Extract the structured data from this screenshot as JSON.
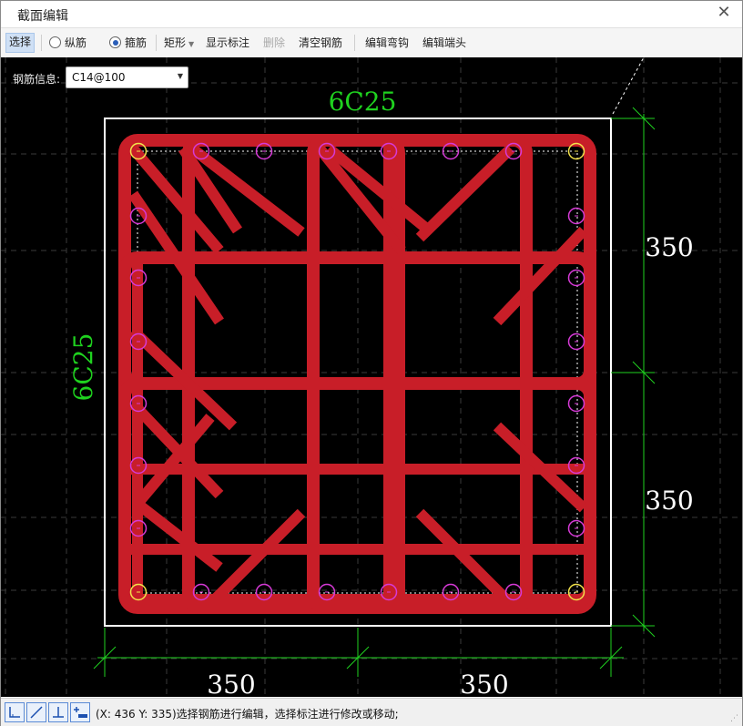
{
  "window": {
    "title": "截面编辑",
    "close_glyph": "✕"
  },
  "toolbar": {
    "select": "选择",
    "longitudinal": "纵筋",
    "stirrup": "箍筋",
    "rect": "矩形",
    "show_dims": "显示标注",
    "delete": "删除",
    "clear": "清空钢筋",
    "edit_hook": "编辑弯钩",
    "edit_end": "编辑端头",
    "active_radio": "stirrup"
  },
  "rebar_info": {
    "label": "钢筋信息:",
    "value": "C14@100"
  },
  "drawing": {
    "top_label": "6C25",
    "left_label": "6C25",
    "right_dims": [
      "350",
      "350"
    ],
    "bottom_dims": [
      "350",
      "350"
    ],
    "colors": {
      "stirrup": "#c81e28",
      "dimension": "#1fd21f",
      "bar_corner": "#f2e24a",
      "bar_side": "#d63ad6",
      "outline": "#ffffff",
      "background": "#000000"
    }
  },
  "status": {
    "text": "(X: 436 Y: 335)选择钢筋进行编辑，选择标注进行修改或移动;",
    "buttons": [
      "corner-snap-icon",
      "diagonal-line-icon",
      "perpendicular-icon",
      "add-dimension-icon"
    ]
  }
}
